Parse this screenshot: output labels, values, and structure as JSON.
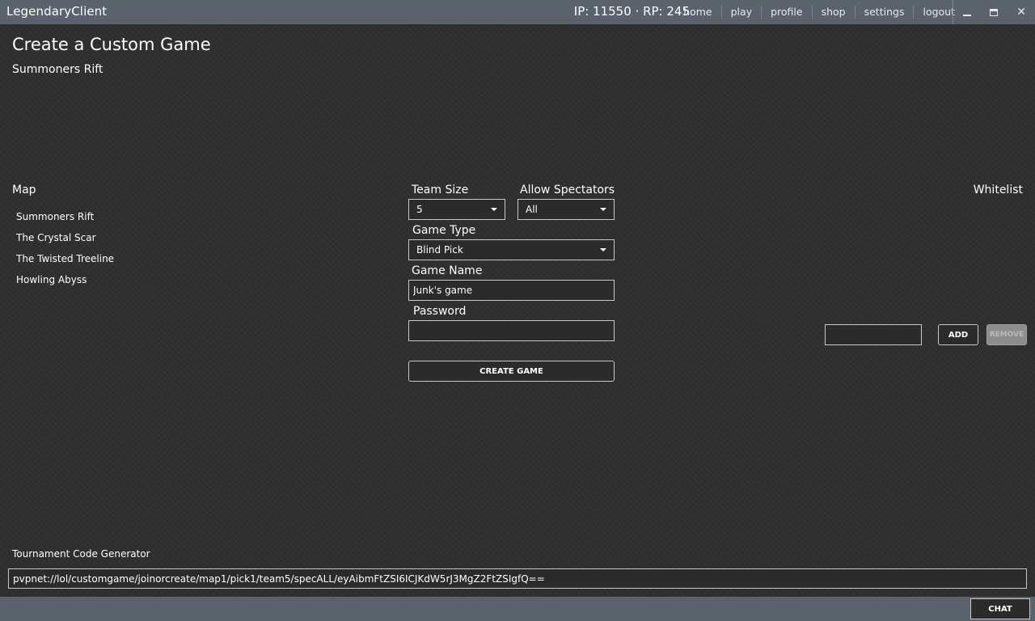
{
  "app": {
    "title": "LegendaryClient",
    "currency": "IP: 11550 · RP: 245",
    "nav": [
      "home",
      "play",
      "profile",
      "shop",
      "settings",
      "logout"
    ],
    "window_controls": {
      "minimize_icon": "minimize-icon",
      "maximize_icon": "maximize-icon",
      "close_glyph": "✕"
    }
  },
  "page": {
    "title": "Create a Custom Game",
    "subtitle": "Summoners Rift"
  },
  "map": {
    "label": "Map",
    "items": [
      "Summoners Rift",
      "The Crystal Scar",
      "The Twisted Treeline",
      "Howling Abyss"
    ]
  },
  "form": {
    "team_size": {
      "label": "Team Size",
      "value": "5"
    },
    "allow_spectators": {
      "label": "Allow Spectators",
      "value": "All"
    },
    "game_type": {
      "label": "Game Type",
      "value": "Blind Pick"
    },
    "game_name": {
      "label": "Game Name",
      "value": "Junk's game"
    },
    "password": {
      "label": "Password",
      "value": ""
    },
    "create_button": "CREATE GAME"
  },
  "whitelist": {
    "label": "Whitelist",
    "input_value": "",
    "add_button": "ADD",
    "remove_button": "REMOVE"
  },
  "tournament": {
    "label": "Tournament Code Generator",
    "code": "pvpnet://lol/customgame/joinorcreate/map1/pick1/team5/specALL/eyAibmFtZSI6ICJKdW5rJ3MgZ2FtZSIgfQ=="
  },
  "bottom": {
    "chat_button": "CHAT"
  },
  "colors": {
    "titlebar": "#5a626c",
    "background": "#2f2f2f",
    "border": "#c8c8c8",
    "disabled_button": "#8d8d8d"
  }
}
